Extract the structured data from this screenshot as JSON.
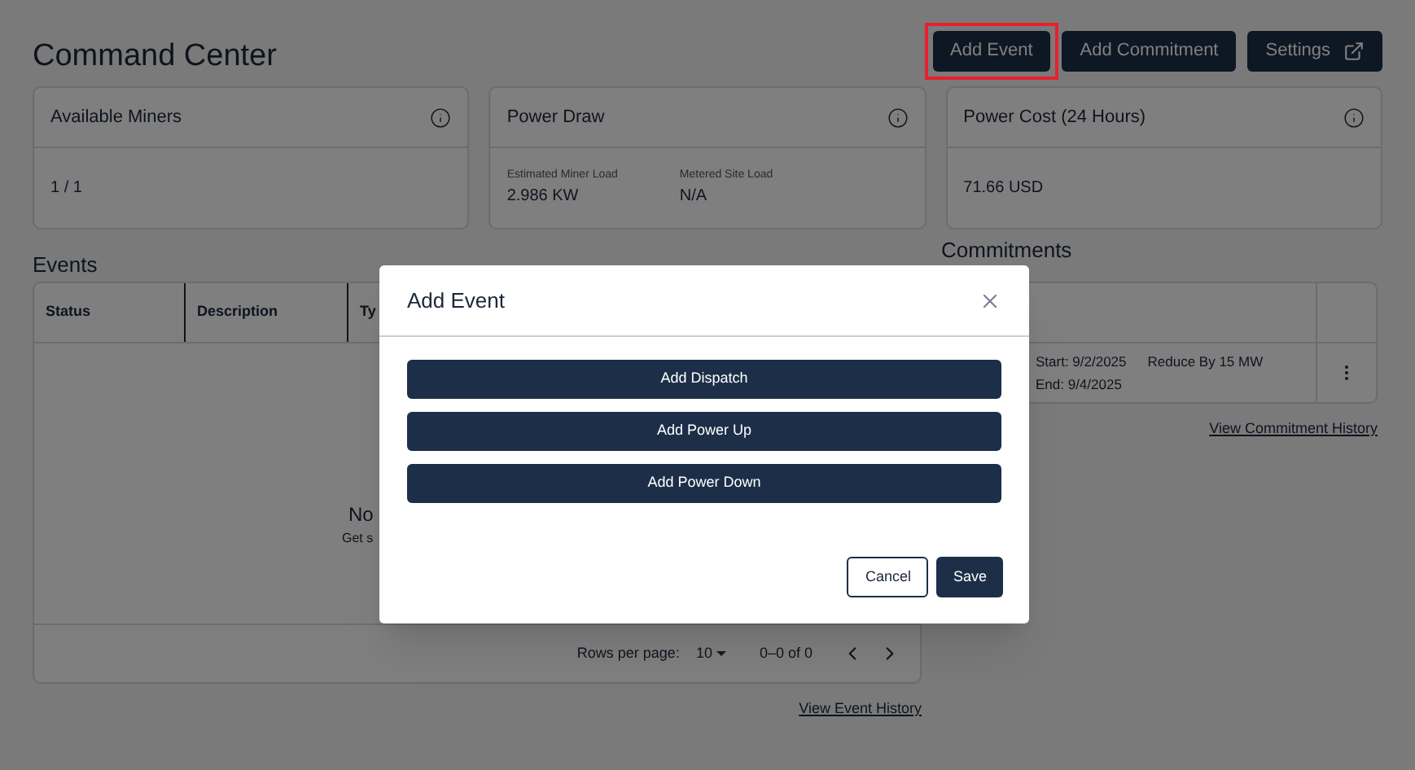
{
  "page": {
    "title": "Command Center"
  },
  "actions": [
    {
      "label": "Add Event",
      "highlighted": true,
      "kind": "plain"
    },
    {
      "label": "Add Commitment",
      "highlighted": false,
      "kind": "plain"
    },
    {
      "label": "Settings",
      "highlighted": false,
      "kind": "external"
    }
  ],
  "cards": [
    {
      "title": "Available Miners",
      "metrics": [
        {
          "value": "1 / 1"
        }
      ]
    },
    {
      "title": "Power Draw",
      "metrics": [
        {
          "label": "Estimated Miner Load",
          "value": "2.986 KW"
        },
        {
          "label": "Metered Site Load",
          "value": "N/A"
        }
      ]
    },
    {
      "title": "Power Cost (24 Hours)",
      "metrics": [
        {
          "value": "71.66 USD"
        }
      ]
    }
  ],
  "events": {
    "title": "Events",
    "columns": [
      "Status",
      "Description",
      "Ty"
    ],
    "empty_title": "No",
    "empty_text": "Get s",
    "rows_per_page_label": "Rows per page:",
    "rows_per_page": "10",
    "range": "0–0 of 0",
    "history_link": "View Event History"
  },
  "commitments": {
    "title": "Commitments",
    "rows": [
      {
        "start": "Start: 9/2/2025",
        "end": "End: 9/4/2025",
        "amount": "Reduce By 15 MW"
      }
    ],
    "history_link": "View Commitment History"
  },
  "dialog": {
    "title": "Add Event",
    "options": [
      "Add Dispatch",
      "Add Power Up",
      "Add Power Down"
    ],
    "cancel": "Cancel",
    "save": "Save"
  }
}
